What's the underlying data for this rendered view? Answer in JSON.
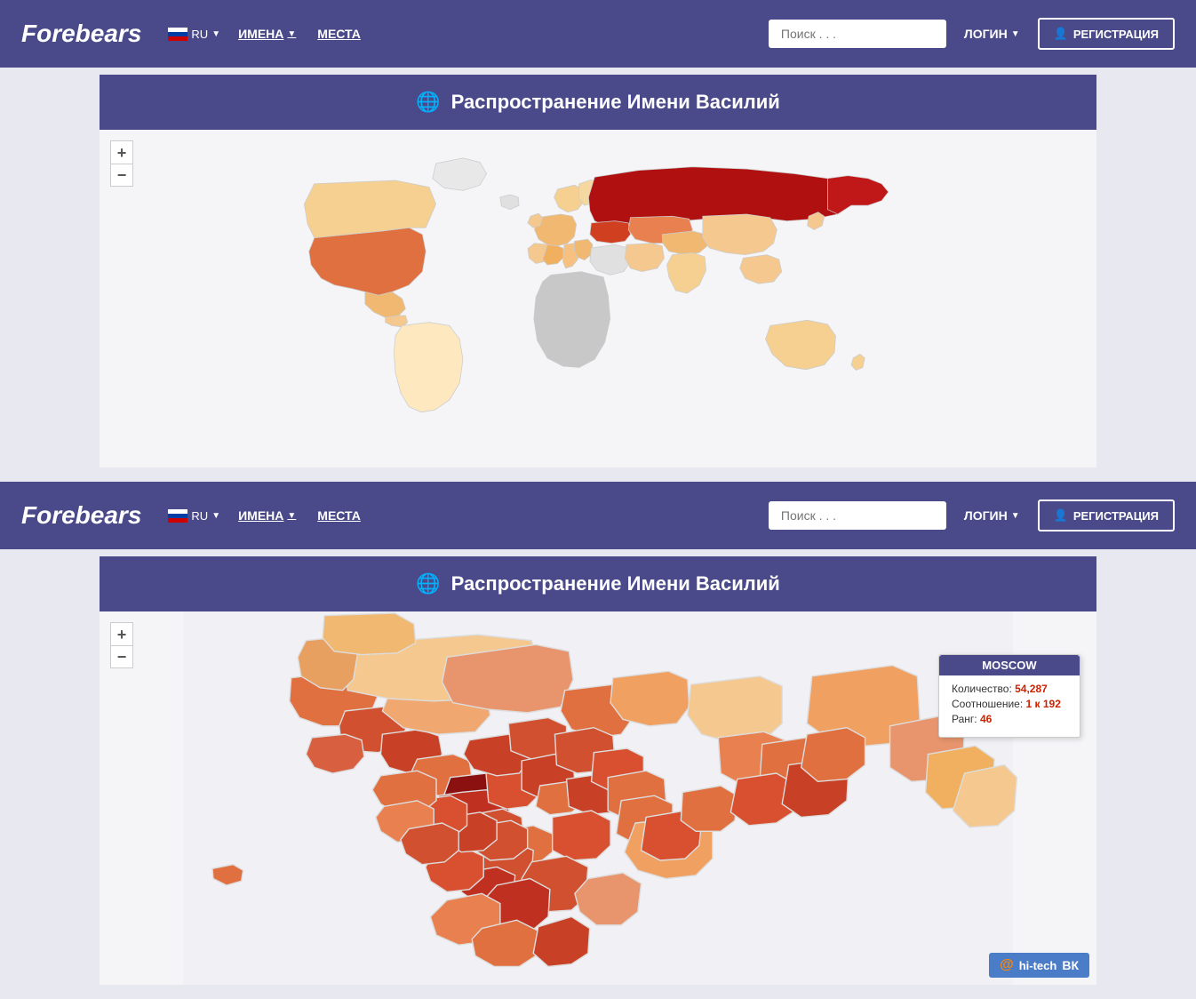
{
  "brand": "Forebears",
  "nav": {
    "lang": "RU",
    "names_label": "ИМЕНА",
    "places_label": "МЕСТА",
    "search_placeholder": "Поиск . . .",
    "login_label": "ЛОГИН",
    "register_label": "РЕГИСТРАЦИЯ"
  },
  "section1": {
    "map_title": "Распространение Имени Василий"
  },
  "section2": {
    "map_title": "Распространение Имени Василий",
    "tooltip": {
      "city": "MOSCOW",
      "count_label": "Количество:",
      "count_val": "54,287",
      "ratio_label": "Соотношение:",
      "ratio_val": "1 к 192",
      "rank_label": "Ранг:",
      "rank_val": "46"
    }
  },
  "controls": {
    "zoom_in": "+",
    "zoom_out": "−"
  },
  "watermark": {
    "at_symbol": "@",
    "text": "hi-tech"
  }
}
